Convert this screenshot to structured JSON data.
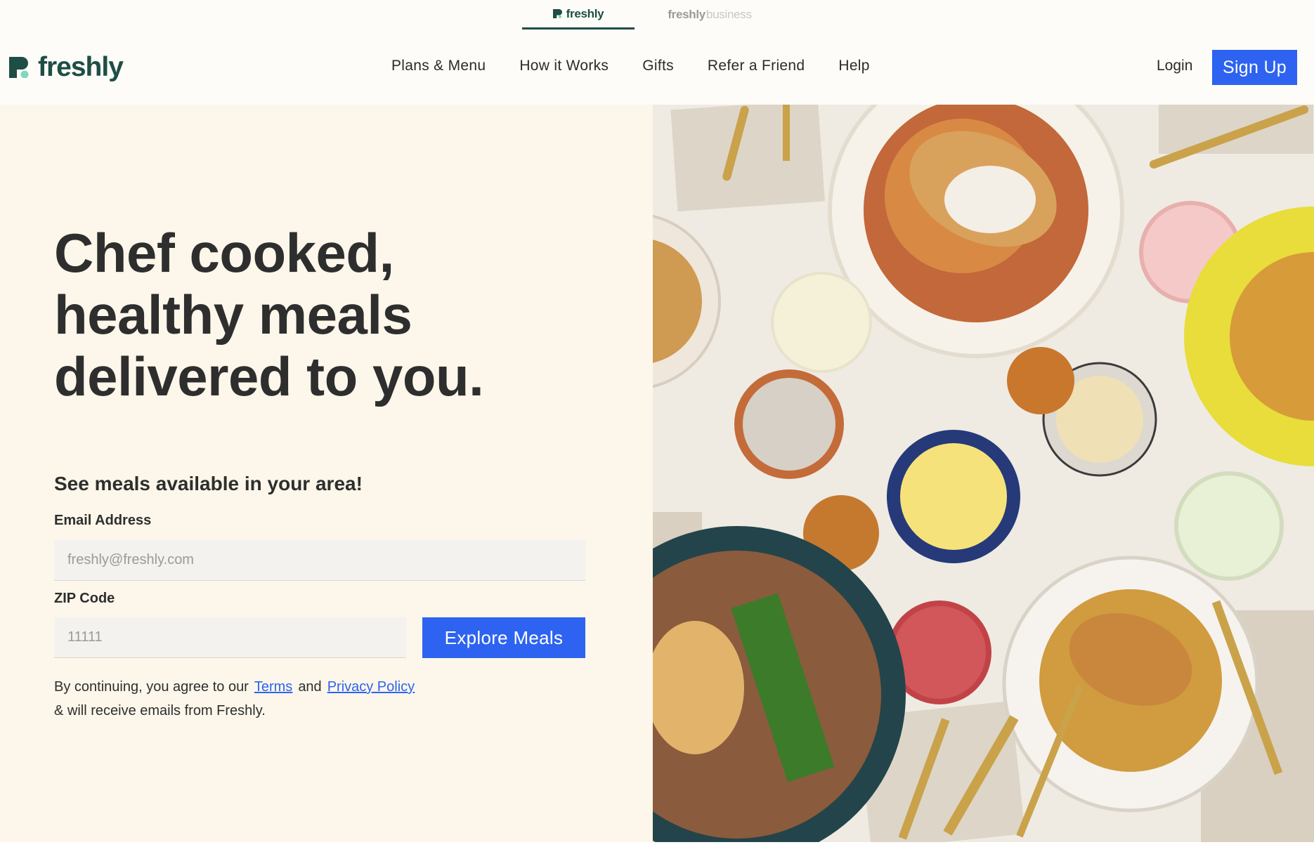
{
  "brand_switcher": {
    "active": "freshly",
    "inactive_main": "freshly",
    "inactive_suffix": "business"
  },
  "header": {
    "logo_text": "freshly",
    "nav": [
      "Plans & Menu",
      "How it Works",
      "Gifts",
      "Refer a Friend",
      "Help"
    ],
    "login_label": "Login",
    "signup_label": "Sign Up"
  },
  "hero": {
    "headline_lines": [
      "Chef cooked,",
      "healthy meals",
      "delivered to you."
    ],
    "subhead": "See meals available in your area!",
    "email_label": "Email Address",
    "email_placeholder": "freshly@freshly.com",
    "zip_label": "ZIP Code",
    "zip_placeholder": "11111",
    "cta_label": "Explore Meals",
    "terms_prefix": "By continuing, you agree to our",
    "terms_link": "Terms",
    "terms_and": "and",
    "privacy_link": "Privacy Policy",
    "terms_suffix": "& will receive emails from Freshly."
  },
  "colors": {
    "brand": "#1e4e46",
    "accent": "#2d63f0",
    "hero_bg": "#fcf7ea"
  }
}
